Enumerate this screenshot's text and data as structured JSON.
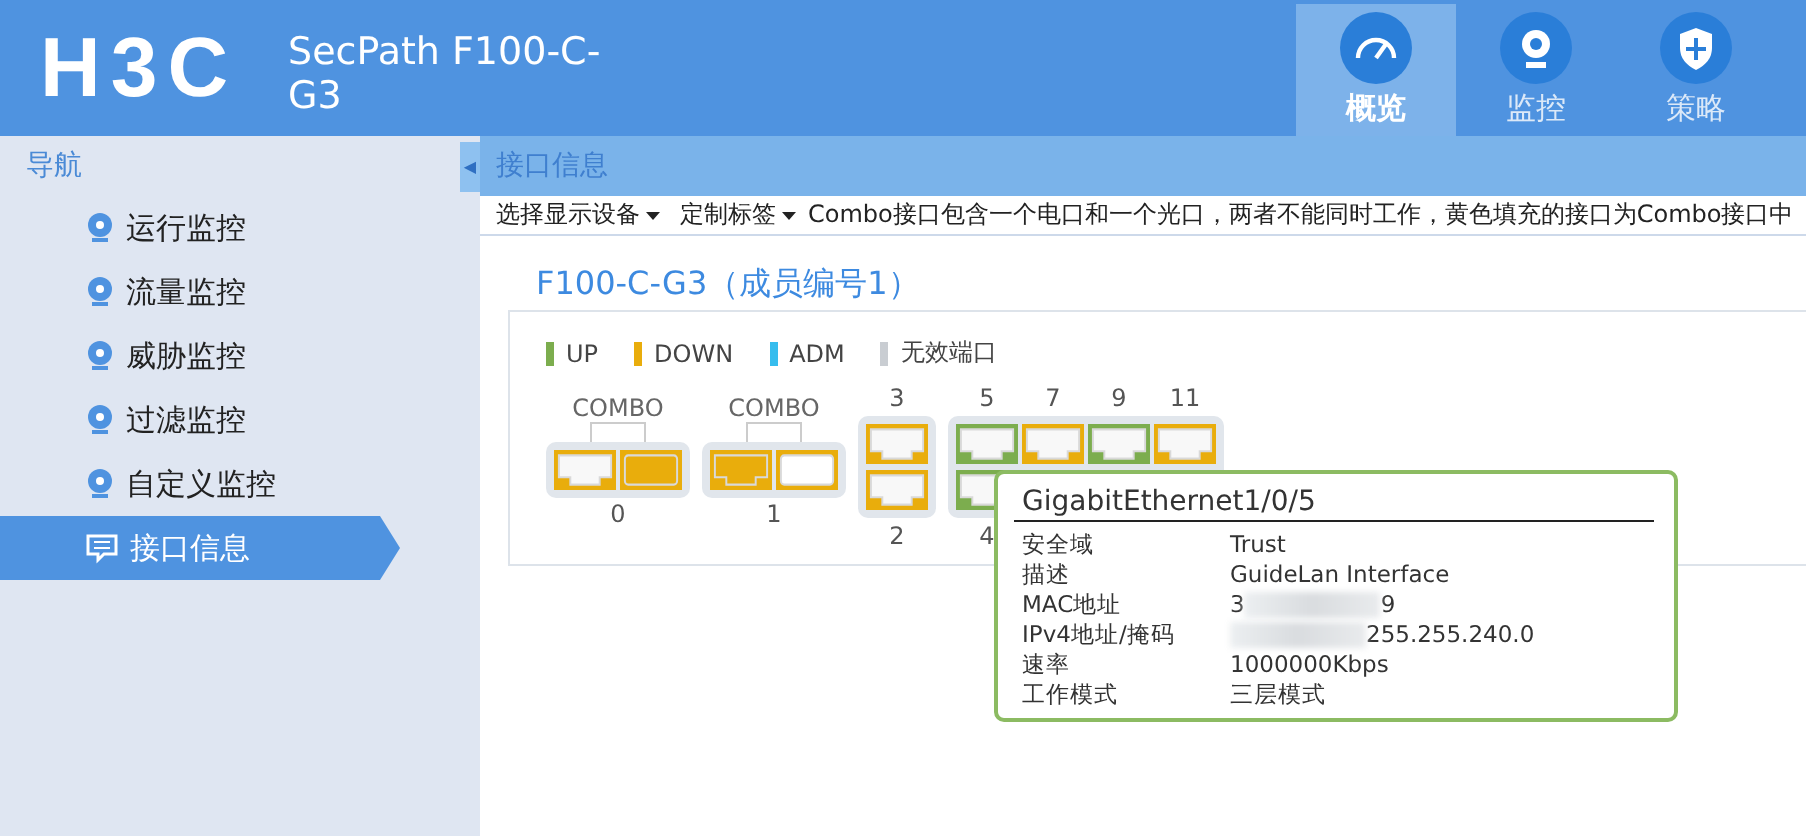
{
  "header": {
    "logo": "H3C",
    "product": "SecPath F100-C-G3",
    "tabs": [
      {
        "label": "概览",
        "selected": true
      },
      {
        "label": "监控",
        "selected": false
      },
      {
        "label": "策略",
        "selected": false
      }
    ]
  },
  "sidebar": {
    "title": "导航",
    "collapse": "◀",
    "items": [
      {
        "label": "运行监控",
        "selected": false
      },
      {
        "label": "流量监控",
        "selected": false
      },
      {
        "label": "威胁监控",
        "selected": false
      },
      {
        "label": "过滤监控",
        "selected": false
      },
      {
        "label": "自定义监控",
        "selected": false
      },
      {
        "label": "接口信息",
        "selected": true
      }
    ]
  },
  "page": {
    "title": "接口信息",
    "toolbar": [
      {
        "kind": "menu",
        "label": "选择显示设备"
      },
      {
        "kind": "menu",
        "label": "定制标签"
      },
      {
        "kind": "note",
        "label": "Combo接口包含一个电口和一个光口，两者不能同时工作，黄色填充的接口为Combo接口中"
      }
    ],
    "device_title": "F100-C-G3（成员编号1）",
    "legend": [
      {
        "label": "UP",
        "color": "#7cad4e"
      },
      {
        "label": "DOWN",
        "color": "#e9ad0c"
      },
      {
        "label": "ADM",
        "color": "#36bdee"
      },
      {
        "label": "无效端口",
        "color": "#c9cdd2"
      }
    ],
    "port_groups": [
      {
        "kind": "combo",
        "label": "COMBO",
        "number": "0",
        "ports": [
          {
            "kind": "copper",
            "color": "#e9ad0c",
            "filled": false
          },
          {
            "kind": "fiber",
            "color": "#e9ad0c",
            "filled": true
          }
        ]
      },
      {
        "kind": "combo",
        "label": "COMBO",
        "number": "1",
        "ports": [
          {
            "kind": "copper",
            "color": "#e9ad0c",
            "filled": true
          },
          {
            "kind": "fiber",
            "color": "#e9ad0c",
            "filled": false
          }
        ]
      },
      {
        "kind": "stack",
        "columns": [
          {
            "top": {
              "number": "3",
              "color": "#e9ad0c"
            },
            "bottom": {
              "number": "2",
              "color": "#e9ad0c"
            }
          }
        ]
      },
      {
        "kind": "stack",
        "columns": [
          {
            "top": {
              "number": "5",
              "color": "#7cad4e"
            },
            "bottom": {
              "number": "4",
              "color": "#7cad4e"
            }
          },
          {
            "top": {
              "number": "7",
              "color": "#e9ad0c"
            }
          },
          {
            "top": {
              "number": "9",
              "color": "#7cad4e"
            }
          },
          {
            "top": {
              "number": "11",
              "color": "#e9ad0c"
            }
          }
        ]
      }
    ],
    "tooltip": {
      "title": "GigabitEthernet1/0/5",
      "rows": [
        {
          "label": "安全域",
          "value": "Trust"
        },
        {
          "label": "描述",
          "value": "GuideLan Interface"
        },
        {
          "label": "MAC地址",
          "value": "3",
          "value_end": "9",
          "redacted": true
        },
        {
          "label": "IPv4地址/掩码",
          "value_end": "255.255.240.0",
          "redacted": true
        },
        {
          "label": "速率",
          "value": "1000000Kbps"
        },
        {
          "label": "工作模式",
          "value": "三层模式"
        }
      ]
    }
  }
}
